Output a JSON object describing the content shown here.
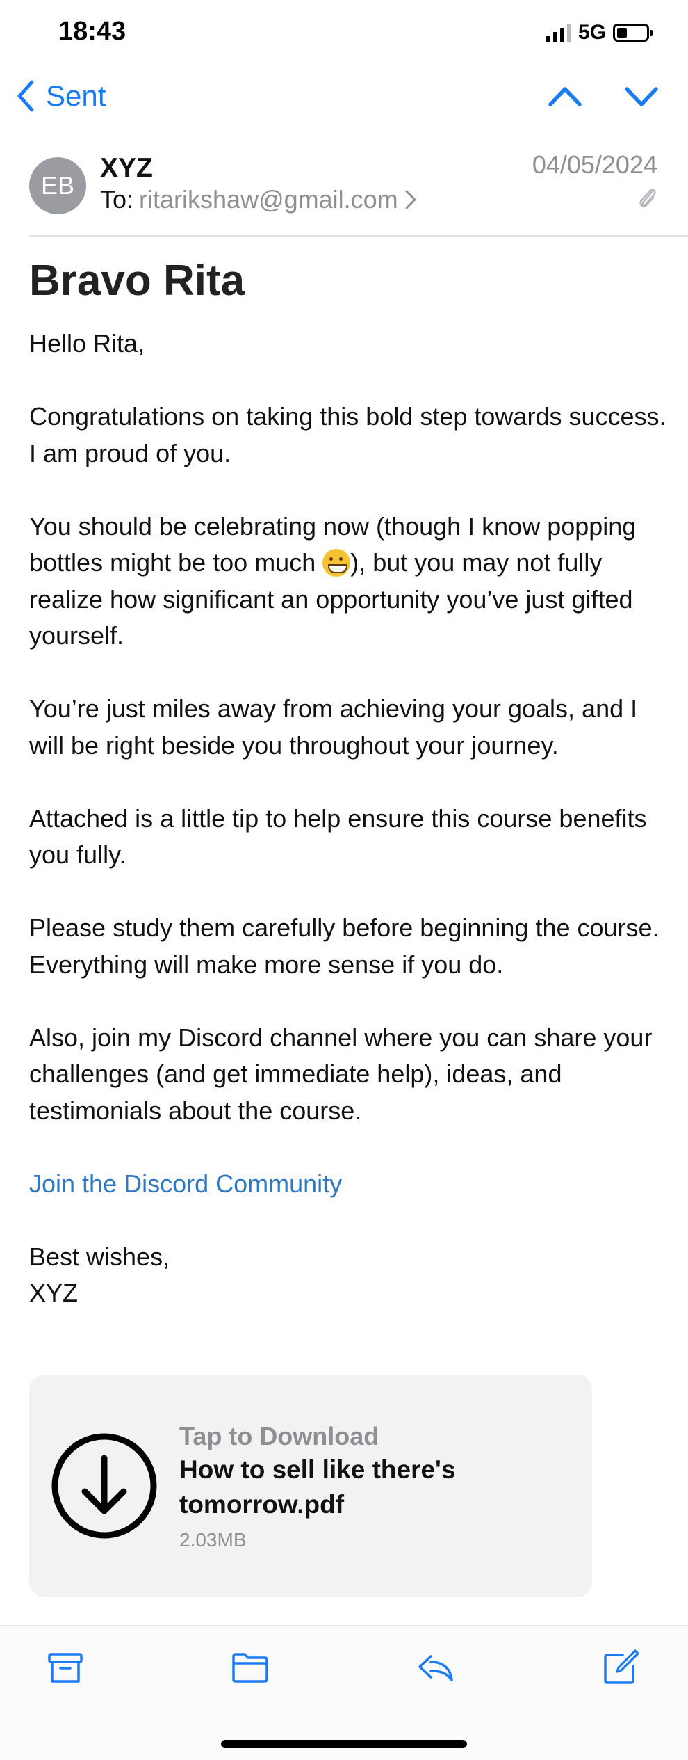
{
  "status": {
    "time": "18:43",
    "network": "5G"
  },
  "nav": {
    "back_label": "Sent"
  },
  "message": {
    "avatar_initials": "EB",
    "sender": "XYZ",
    "to_label": "To:",
    "recipient": "ritarikshaw@gmail.com",
    "date": "04/05/2024",
    "subject": "Bravo Rita",
    "greeting": "Hello Rita,",
    "para1": "Congratulations on taking this bold step towards success. I am proud of you.",
    "para2_before": "You should be celebrating now (though I know popping bottles might be too much ",
    "para2_after": "), but you may not fully realize how significant an opportunity you’ve just gifted yourself.",
    "para3": "You’re just miles away from achieving your goals, and I will be right beside you throughout your journey.",
    "para4": "Attached is a little tip to help ensure this course benefits you fully.",
    "para5": "Please study them carefully before beginning the course. Everything will make more sense if you do.",
    "para6": "Also, join my Discord channel where you can share your challenges (and get immediate help), ideas, and testimonials about the course.",
    "link_text": "Join the Discord Community",
    "signoff": "Best wishes,",
    "signature": "XYZ"
  },
  "attachment": {
    "tap_label": "Tap to Download",
    "file_name": "How to sell like there's tomorrow.pdf",
    "file_size": "2.03MB"
  },
  "icons": {
    "back": "chevron-left-icon",
    "prev": "chevron-up-icon",
    "next": "chevron-down-icon",
    "archive": "archive-icon",
    "move": "folder-icon",
    "reply": "reply-icon",
    "compose": "compose-icon",
    "download": "download-icon",
    "attachment": "paperclip-icon"
  },
  "colors": {
    "accent": "#1a7cf4",
    "link": "#2e78c4",
    "secondary_text": "#8e8e93",
    "avatar": "#9a9ca2",
    "card": "#f2f2f2"
  }
}
